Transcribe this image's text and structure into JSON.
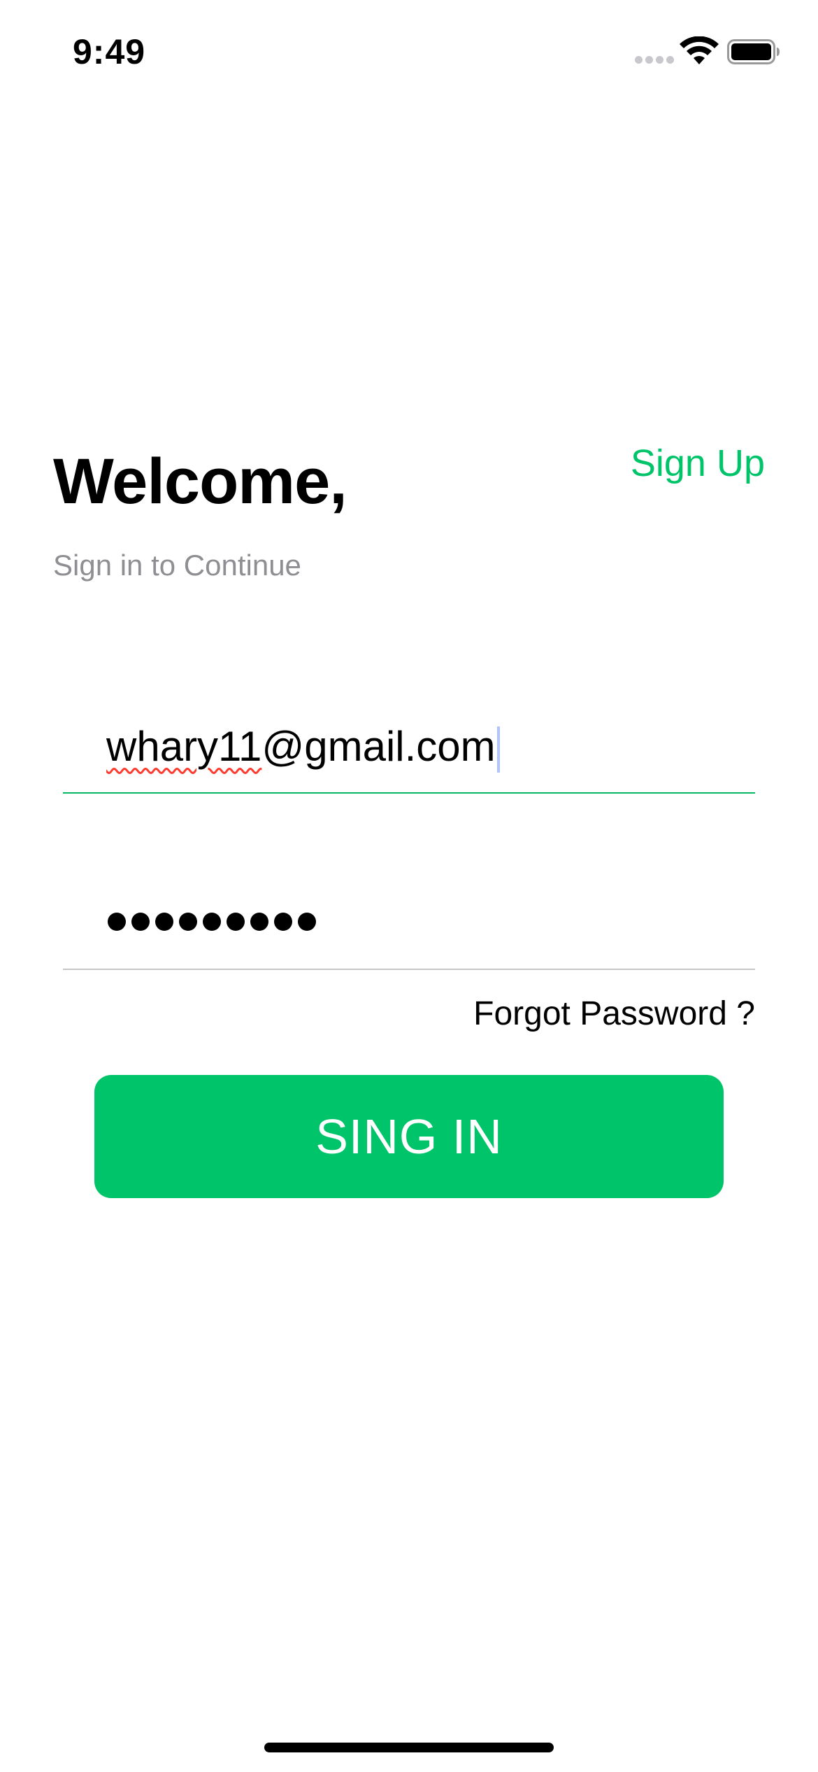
{
  "status_bar": {
    "time": "9:49",
    "icons": [
      "signal-icon",
      "wifi-icon",
      "battery-icon"
    ]
  },
  "header": {
    "title": "Welcome,",
    "subtitle": "Sign in to Continue",
    "sign_up_label": "Sign Up"
  },
  "form": {
    "email_value_misspelled": "whary11",
    "email_value_rest": "@gmail.com",
    "password_masked": "•••••••••",
    "password_length": 9,
    "forgot_password_label": "Forgot Password ?",
    "submit_label": "SING IN"
  },
  "colors": {
    "accent": "#00c46a",
    "subtitle": "#8e8e93",
    "divider": "#c6c6c8",
    "spellcheck": "#ff3b30"
  }
}
